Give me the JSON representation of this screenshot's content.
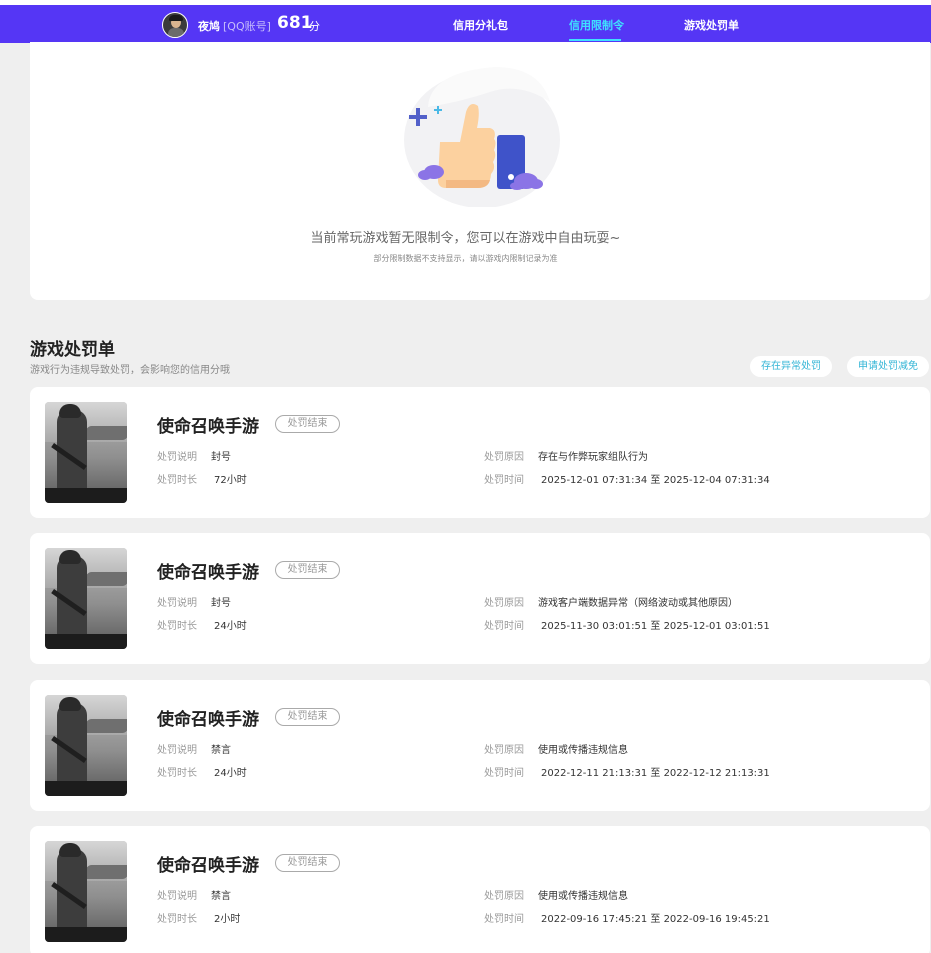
{
  "header": {
    "username": "夜鸠",
    "account_type": "[QQ账号]",
    "score": "681",
    "score_unit": "分",
    "nav": [
      "信用分礼包",
      "信用限制令",
      "游戏处罚单"
    ],
    "active_nav": "信用限制令",
    "colors": {
      "bar": "#5536f5",
      "active": "#3fe0ff"
    }
  },
  "restriction": {
    "empty_text": "当前常玩游戏暂无限制令，您可以在游戏中自由玩耍~",
    "empty_note": "部分限制数据不支持显示，请以游戏内限制记录为准"
  },
  "penalties": {
    "title": "游戏处罚单",
    "subtitle": "游戏行为违规导致处罚，会影响您的信用分哦",
    "btn_abnormal": "存在异常处罚",
    "btn_appeal": "申请处罚减免",
    "labels": {
      "desc": "处罚说明",
      "duration": "处罚时长",
      "reason": "处罚原因",
      "time": "处罚时间"
    },
    "items": [
      {
        "game": "使命召唤手游",
        "status": "处罚结束",
        "desc": "封号",
        "duration": "72小时",
        "reason": "存在与作弊玩家组队行为",
        "time": "2025-12-01 07:31:34 至 2025-12-04 07:31:34"
      },
      {
        "game": "使命召唤手游",
        "status": "处罚结束",
        "desc": "封号",
        "duration": "24小时",
        "reason": "游戏客户端数据异常（网络波动或其他原因）",
        "time": "2025-11-30 03:01:51 至 2025-12-01 03:01:51"
      },
      {
        "game": "使命召唤手游",
        "status": "处罚结束",
        "desc": "禁言",
        "duration": "24小时",
        "reason": "使用或传播违规信息",
        "time": "2022-12-11 21:13:31 至 2022-12-12 21:13:31"
      },
      {
        "game": "使命召唤手游",
        "status": "处罚结束",
        "desc": "禁言",
        "duration": "2小时",
        "reason": "使用或传播违规信息",
        "time": "2022-09-16 17:45:21 至 2022-09-16 19:45:21"
      }
    ]
  }
}
